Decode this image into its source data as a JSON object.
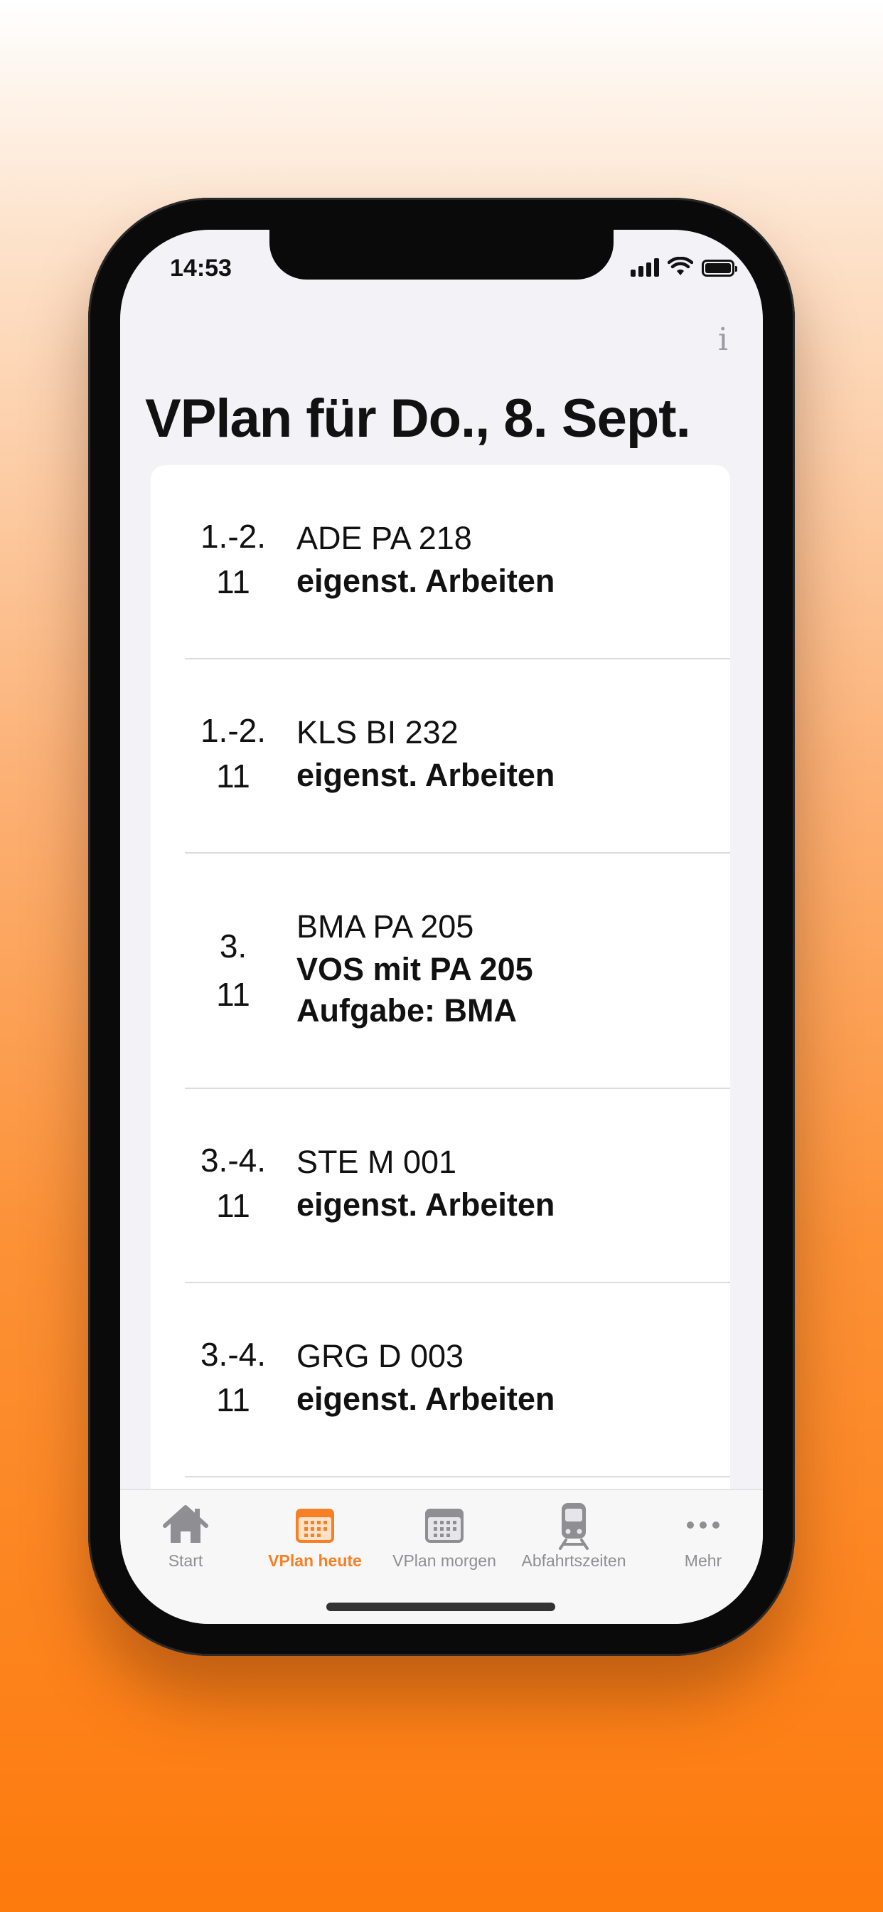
{
  "status_bar": {
    "time": "14:53"
  },
  "info_label": "i",
  "page_title": "VPlan für Do., 8. Sept.",
  "entries": [
    {
      "period": "1.-2.",
      "grade": "11",
      "subject": "ADE PA 218",
      "note": [
        "eigenst. Arbeiten"
      ]
    },
    {
      "period": "1.-2.",
      "grade": "11",
      "subject": "KLS BI 232",
      "note": [
        "eigenst. Arbeiten"
      ]
    },
    {
      "period": "3.",
      "grade": "11",
      "subject": "BMA PA 205",
      "note": [
        "VOS mit PA 205",
        "Aufgabe: BMA"
      ]
    },
    {
      "period": "3.-4.",
      "grade": "11",
      "subject": "STE M 001",
      "note": [
        "eigenst. Arbeiten"
      ]
    },
    {
      "period": "3.-4.",
      "grade": "11",
      "subject": "GRG D 003",
      "note": [
        "eigenst. Arbeiten"
      ]
    }
  ],
  "tabs": [
    {
      "label": "Start",
      "icon": "house-icon",
      "active": false
    },
    {
      "label": "VPlan heute",
      "icon": "calendar-icon",
      "active": true
    },
    {
      "label": "VPlan morgen",
      "icon": "calendar-icon",
      "active": false
    },
    {
      "label": "Abfahrtszeiten",
      "icon": "train-icon",
      "active": false
    },
    {
      "label": "Mehr",
      "icon": "more-icon",
      "active": false
    }
  ],
  "colors": {
    "accent": "#f58025",
    "inactive": "#8e8e93"
  }
}
